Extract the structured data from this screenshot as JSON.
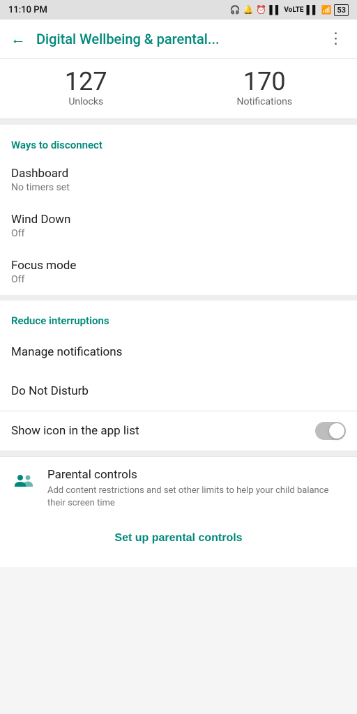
{
  "statusBar": {
    "time": "11:10 PM",
    "battery": "53"
  },
  "appBar": {
    "title": "Digital Wellbeing & parental...",
    "backLabel": "←",
    "moreLabel": "⋮"
  },
  "stats": {
    "unlocks": "127",
    "unlocks_label": "Unlocks",
    "notifications": "170",
    "notifications_label": "Notifications"
  },
  "sections": {
    "disconnect": {
      "header": "Ways to disconnect",
      "items": [
        {
          "title": "Dashboard",
          "subtitle": "No timers set"
        },
        {
          "title": "Wind Down",
          "subtitle": "Off"
        },
        {
          "title": "Focus mode",
          "subtitle": "Off"
        }
      ]
    },
    "interruptions": {
      "header": "Reduce interruptions",
      "items": [
        {
          "title": "Manage notifications",
          "subtitle": ""
        },
        {
          "title": "Do Not Disturb",
          "subtitle": ""
        }
      ],
      "toggleItem": {
        "label": "Show icon in the app list",
        "state": false
      }
    }
  },
  "parental": {
    "title": "Parental controls",
    "description": "Add content restrictions and set other limits to help your child balance their screen time",
    "setup_label": "Set up parental controls"
  }
}
